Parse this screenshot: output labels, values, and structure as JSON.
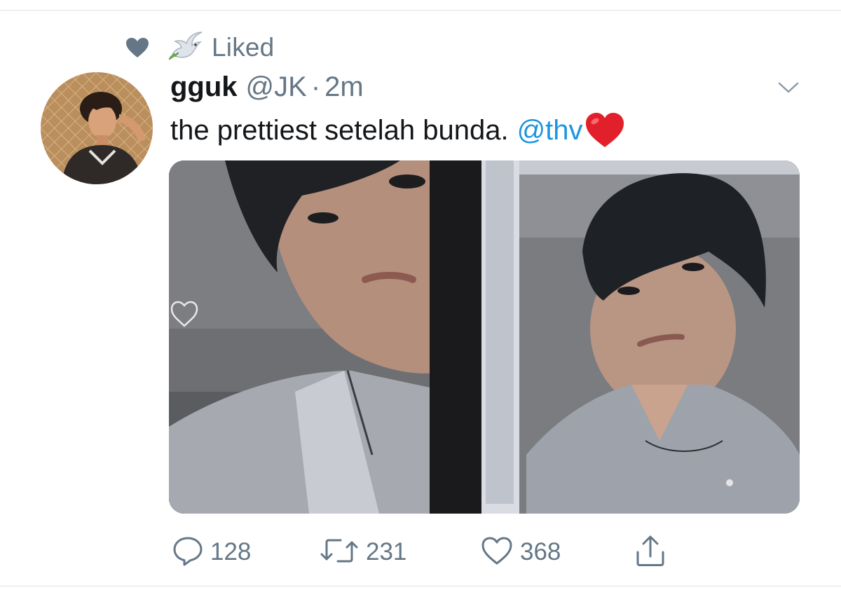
{
  "social_context": {
    "label": "Liked",
    "heart_icon": "heart-filled-icon",
    "dove_icon": "dove-emoji-icon"
  },
  "tweet": {
    "display_name": "gguk",
    "handle": "@JK",
    "separator": "·",
    "timestamp": "2m",
    "text": "the prettiest setelah bunda.",
    "mention": "@thv",
    "emoji_icon": "red-heart-emoji-icon",
    "more_icon": "chevron-down-icon"
  },
  "media": {
    "overlay_icon": "heart-outline-icon"
  },
  "actions": {
    "reply_count": "128",
    "retweet_count": "231",
    "like_count": "368",
    "share_icon": "share-icon"
  },
  "colors": {
    "accent": "#1b95e0",
    "muted": "#657786",
    "text": "#14171a",
    "icon_gray": "#657786",
    "heart_red": "#e0245e"
  }
}
